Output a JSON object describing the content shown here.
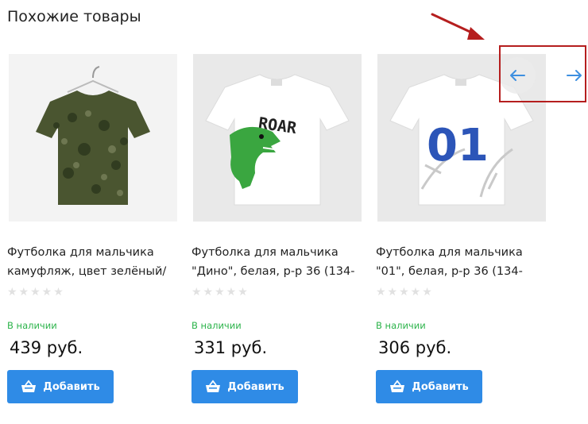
{
  "section": {
    "title": "Похожие товары"
  },
  "products": [
    {
      "name": "Футболка для мальчика камуфляж, цвет зелёный/",
      "rating_stars": "★★★★★",
      "availability": "В наличии",
      "price": "439 руб.",
      "add_label": "Добавить"
    },
    {
      "name": "Футболка для мальчика \"Дино\", белая, р-р 36 (134-",
      "rating_stars": "★★★★★",
      "availability": "В наличии",
      "price": "331 руб.",
      "add_label": "Добавить"
    },
    {
      "name": "Футболка для мальчика \"01\", белая, р-р 36 (134-",
      "rating_stars": "★★★★★",
      "availability": "В наличии",
      "price": "306 руб.",
      "add_label": "Добавить"
    }
  ],
  "graphics": {
    "print_text_dino": "ROAR",
    "print_text_number": "01"
  },
  "carousel": {
    "prev_icon": "arrow-left-icon",
    "next_icon": "arrow-right-icon"
  },
  "colors": {
    "accent": "#2f8be6",
    "in_stock": "#2bb34a",
    "annotation": "#b51e1e",
    "arrow_icon": "#3d8fe0"
  }
}
